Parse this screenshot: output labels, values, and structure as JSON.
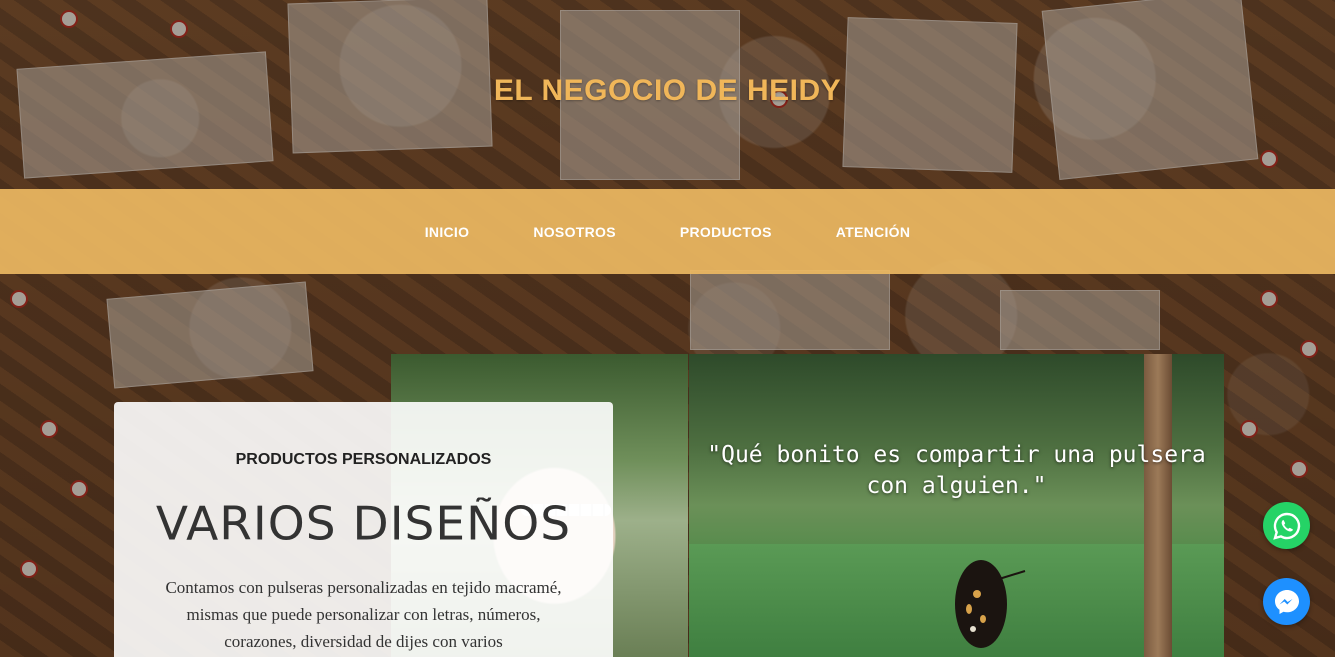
{
  "site": {
    "title": "EL NEGOCIO DE HEIDY"
  },
  "nav": {
    "items": [
      {
        "label": "INICIO"
      },
      {
        "label": "NOSOTROS"
      },
      {
        "label": "PRODUCTOS"
      },
      {
        "label": "ATENCIÓN"
      }
    ]
  },
  "hero": {
    "quote": "\"Qué bonito es compartir una pulsera con alguien.\""
  },
  "card": {
    "kicker": "PRODUCTOS PERSONALIZADOS",
    "title": "VARIOS DISEÑOS",
    "body": "Contamos con pulseras personalizadas en tejido macramé, mismas que puede personalizar con letras, números, corazones, diversidad de dijes con varios"
  },
  "floating": {
    "whatsapp_icon": "whatsapp-icon",
    "messenger_icon": "messenger-icon"
  },
  "colors": {
    "accent": "#f0b659",
    "navbar": "#ecb862",
    "whatsapp": "#25d366",
    "messenger": "#1e90ff"
  }
}
